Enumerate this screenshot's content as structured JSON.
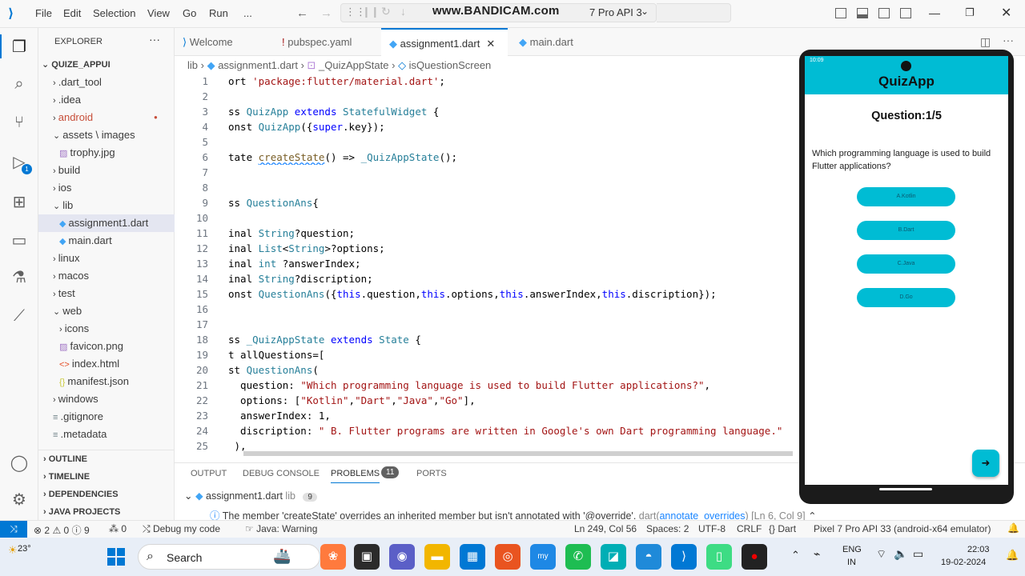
{
  "titlebar": {
    "menus": [
      "File",
      "Edit",
      "Selection",
      "View",
      "Go",
      "Run",
      "..."
    ],
    "watermark": "www.BANDICAM.com",
    "device_text": "7 Pro API 3"
  },
  "sidebar": {
    "header": "EXPLORER",
    "root": "QUIZE_APPUI",
    "items": [
      {
        "label": ".dart_tool",
        "kind": "folder-closed",
        "indent": 1
      },
      {
        "label": ".idea",
        "kind": "folder-closed",
        "indent": 1
      },
      {
        "label": "android",
        "kind": "folder-closed",
        "indent": 1,
        "modified": true
      },
      {
        "label": "assets \\ images",
        "kind": "folder-open",
        "indent": 1
      },
      {
        "label": "trophy.jpg",
        "kind": "image",
        "indent": 2
      },
      {
        "label": "build",
        "kind": "folder-closed",
        "indent": 1
      },
      {
        "label": "ios",
        "kind": "folder-closed",
        "indent": 1
      },
      {
        "label": "lib",
        "kind": "folder-open",
        "indent": 1
      },
      {
        "label": "assignment1.dart",
        "kind": "dart",
        "indent": 2,
        "selected": true
      },
      {
        "label": "main.dart",
        "kind": "dart",
        "indent": 2
      },
      {
        "label": "linux",
        "kind": "folder-closed",
        "indent": 1
      },
      {
        "label": "macos",
        "kind": "folder-closed",
        "indent": 1
      },
      {
        "label": "test",
        "kind": "folder-closed",
        "indent": 1
      },
      {
        "label": "web",
        "kind": "folder-open",
        "indent": 1
      },
      {
        "label": "icons",
        "kind": "folder-closed",
        "indent": 2
      },
      {
        "label": "favicon.png",
        "kind": "image",
        "indent": 2
      },
      {
        "label": "index.html",
        "kind": "html",
        "indent": 2
      },
      {
        "label": "manifest.json",
        "kind": "json",
        "indent": 2
      },
      {
        "label": "windows",
        "kind": "folder-closed",
        "indent": 1
      },
      {
        "label": ".gitignore",
        "kind": "file",
        "indent": 1
      },
      {
        "label": ".metadata",
        "kind": "file",
        "indent": 1
      }
    ],
    "sections": [
      "OUTLINE",
      "TIMELINE",
      "DEPENDENCIES",
      "JAVA PROJECTS"
    ]
  },
  "tabs": [
    {
      "label": "Welcome",
      "icon": "vscode-icon"
    },
    {
      "label": "pubspec.yaml",
      "icon": "yaml-icon"
    },
    {
      "label": "assignment1.dart",
      "icon": "dart-icon",
      "active": true
    },
    {
      "label": "main.dart",
      "icon": "dart-icon"
    }
  ],
  "breadcrumb": [
    "lib",
    "assignment1.dart",
    "_QuizAppState",
    "isQuestionScreen"
  ],
  "code_lines": [
    {
      "n": "1",
      "t": "ort 'package:flutter/material.dart';"
    },
    {
      "n": "2",
      "t": ""
    },
    {
      "n": "3",
      "t": "ss QuizApp extends StatefulWidget {"
    },
    {
      "n": "4",
      "t": "onst QuizApp({super.key});"
    },
    {
      "n": "5",
      "t": ""
    },
    {
      "n": "6",
      "t": "tate createState() => _QuizAppState();"
    },
    {
      "n": "7",
      "t": ""
    },
    {
      "n": "8",
      "t": ""
    },
    {
      "n": "9",
      "t": "ss QuestionAns{"
    },
    {
      "n": "10",
      "t": ""
    },
    {
      "n": "11",
      "t": "inal String?question;"
    },
    {
      "n": "12",
      "t": "inal List<String>?options;"
    },
    {
      "n": "13",
      "t": "inal int ?answerIndex;"
    },
    {
      "n": "14",
      "t": "inal String?discription;"
    },
    {
      "n": "15",
      "t": "onst QuestionAns({this.question,this.options,this.answerIndex,this.discription});"
    },
    {
      "n": "16",
      "t": ""
    },
    {
      "n": "17",
      "t": ""
    },
    {
      "n": "18",
      "t": "ss _QuizAppState extends State {"
    },
    {
      "n": "19",
      "t": "t allQuestions=["
    },
    {
      "n": "20",
      "t": "st QuestionAns("
    },
    {
      "n": "21",
      "t": "  question: \"Which programming language is used to build Flutter applications?\","
    },
    {
      "n": "22",
      "t": "  options: [\"Kotlin\",\"Dart\",\"Java\",\"Go\"],"
    },
    {
      "n": "23",
      "t": "  answerIndex: 1,"
    },
    {
      "n": "24",
      "t": "  discription: \" B. Flutter programs are written in Google's own Dart programming language.\""
    },
    {
      "n": "25",
      "t": " ),"
    }
  ],
  "panel": {
    "tabs": [
      "OUTPUT",
      "DEBUG CONSOLE",
      "PROBLEMS",
      "PORTS"
    ],
    "problems_count": "11",
    "file": "assignment1.dart",
    "file_dir": "lib",
    "file_count": "9",
    "message": "The member 'createState' overrides an inherited member but isn't annotated with '@override'.",
    "source": "dart(",
    "rule": "annotate_overrides",
    "source_end": ")",
    "location": "[Ln 6, Col 9]"
  },
  "statusbar": {
    "errors": "2",
    "warnings": "0",
    "infos": "9",
    "ports": "0",
    "debug": "Debug my code",
    "java": "Java: Warning",
    "position": "Ln 249, Col 56",
    "spaces": "Spaces: 2",
    "encoding": "UTF-8",
    "eol": "CRLF",
    "language": "Dart",
    "device": "Pixel 7 Pro API 33 (android-x64 emulator)"
  },
  "phone": {
    "time": "10:09",
    "app_title": "QuizApp",
    "question_header": "Question:1/5",
    "question_text": "Which programming language is used to build Flutter applications?",
    "options": [
      "A.Kotlin",
      "B.Dart",
      "C.Java",
      "D.Go"
    ],
    "accent": "#00bcd4"
  },
  "taskbar": {
    "weather_temp": "23°",
    "search": "Search",
    "lang1": "ENG",
    "lang2": "IN",
    "time": "22:03",
    "date": "19-02-2024"
  }
}
